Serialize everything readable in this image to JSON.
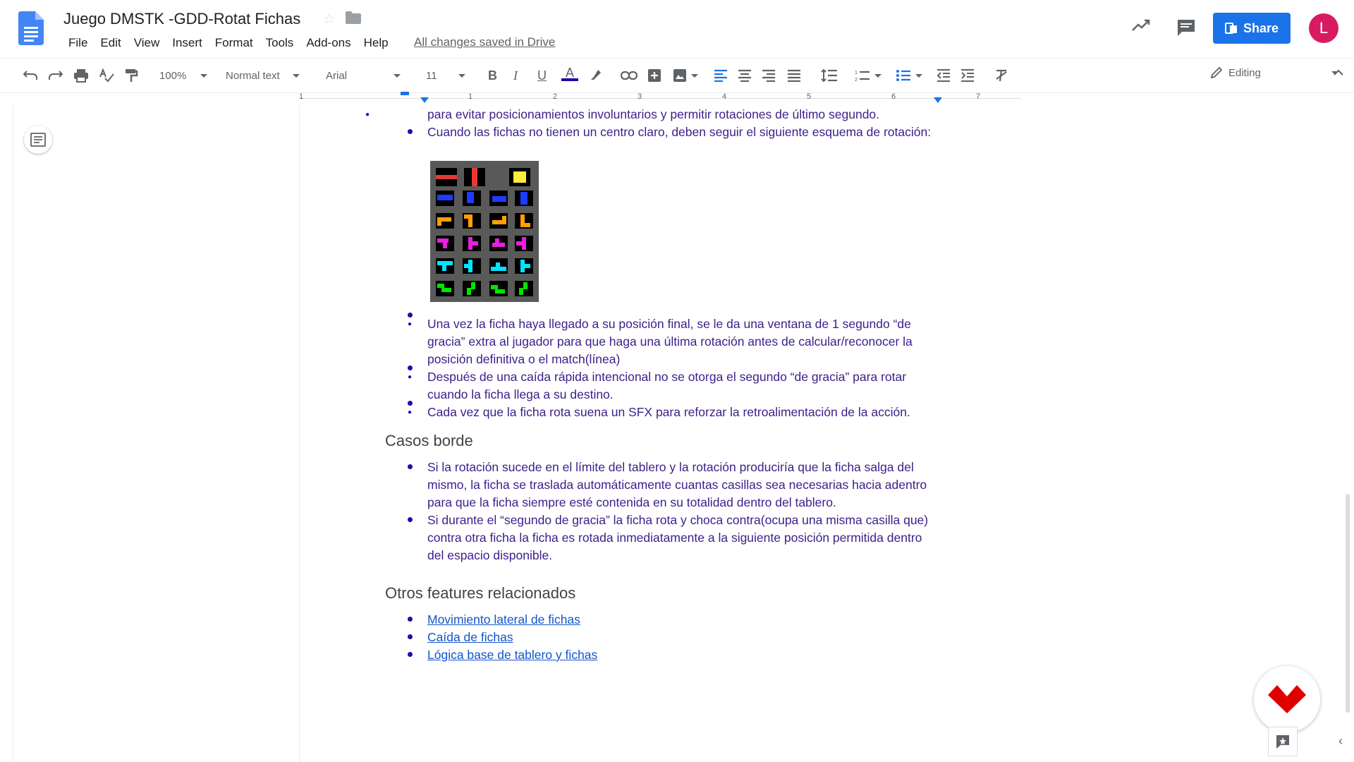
{
  "app": {
    "title": "Juego DMSTK -GDD-Rotat Fichas",
    "menu": [
      "File",
      "Edit",
      "View",
      "Insert",
      "Format",
      "Tools",
      "Add-ons",
      "Help"
    ],
    "saved_status": "All changes saved in Drive",
    "share_label": "Share",
    "avatar_letter": "L",
    "accent_color": "#1a73e8"
  },
  "toolbar": {
    "zoom": "100%",
    "style": "Normal text",
    "font": "Arial",
    "size": "11",
    "mode": "Editing"
  },
  "ruler": {
    "numbers": [
      "1",
      "1",
      "2",
      "3",
      "4",
      "5",
      "6",
      "7"
    ]
  },
  "doc": {
    "bullets_top": [
      "para evitar posicionamientos involuntarios y permitir rotaciones de último segundo.",
      "Cuando las fichas no tienen un centro claro, deben seguir el siguiente esquema de rotación:",
      "Una vez la ficha haya llegado a su posición final, se le da una ventana de 1 segundo “de gracia” extra al jugador para que haga una última rotación antes de calcular/reconocer la posición definitiva o el match(línea)",
      "Después de una caída rápida intencional no se otorga el segundo “de gracia” para rotar cuando la ficha llega a su destino.",
      "Cada vez que la ficha rota suena un SFX para reforzar la retroalimentación de la acción."
    ],
    "heading_casos": "Casos borde",
    "bullets_casos": [
      "Si la rotación sucede en el límite del tablero y la rotación produciría que la ficha salga del mismo, la ficha se traslada automáticamente cuantas casillas sea necesarias hacia adentro para que la ficha siempre esté contenida en su totalidad dentro del tablero.",
      "Si durante el “segundo de gracia” la ficha rota y choca contra(ocupa una misma casilla que) contra otra ficha la ficha es rotada inmediatamente a la siguiente posición permitida dentro del espacio disponible."
    ],
    "heading_otros": "Otros features relacionados",
    "links": [
      "Movimiento lateral de fichas",
      "Caída de fichas",
      "Lógica base de tablero y fichas"
    ]
  }
}
